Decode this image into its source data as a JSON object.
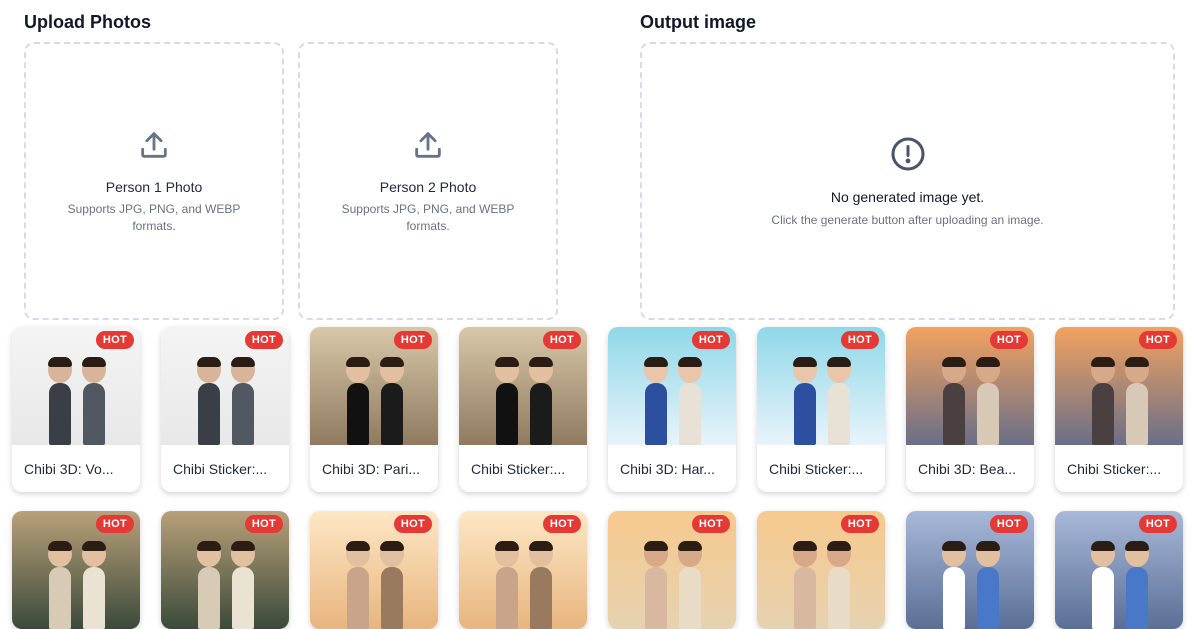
{
  "upload": {
    "title": "Upload Photos",
    "person1": {
      "label": "Person 1 Photo",
      "hint": "Supports JPG, PNG, and WEBP formats."
    },
    "person2": {
      "label": "Person 2 Photo",
      "hint": "Supports JPG, PNG, and WEBP formats."
    }
  },
  "output": {
    "title": "Output image",
    "empty_title": "No generated image yet.",
    "empty_hint": "Click the generate button after uploading an image."
  },
  "badge": "HOT",
  "templates_row1": [
    {
      "label": "Chibi 3D: Vo...",
      "badge": "HOT",
      "scene": "vogue"
    },
    {
      "label": "Chibi Sticker:...",
      "badge": "HOT",
      "scene": "vogue"
    },
    {
      "label": "Chibi 3D: Pari...",
      "badge": "HOT",
      "scene": "paris"
    },
    {
      "label": "Chibi Sticker:...",
      "badge": "HOT",
      "scene": "paris"
    },
    {
      "label": "Chibi 3D: Har...",
      "badge": "HOT",
      "scene": "ice"
    },
    {
      "label": "Chibi Sticker:...",
      "badge": "HOT",
      "scene": "ice"
    },
    {
      "label": "Chibi 3D: Bea...",
      "badge": "HOT",
      "scene": "sunset"
    },
    {
      "label": "Chibi Sticker:...",
      "badge": "HOT",
      "scene": "sunset"
    }
  ],
  "templates_row2": [
    {
      "badge": "HOT",
      "scene": "coast"
    },
    {
      "badge": "HOT",
      "scene": "coast"
    },
    {
      "badge": "HOT",
      "scene": "golden"
    },
    {
      "badge": "HOT",
      "scene": "golden"
    },
    {
      "badge": "HOT",
      "scene": "beach"
    },
    {
      "badge": "HOT",
      "scene": "beach"
    },
    {
      "badge": "HOT",
      "scene": "santorini"
    },
    {
      "badge": "HOT",
      "scene": "santorini"
    }
  ]
}
